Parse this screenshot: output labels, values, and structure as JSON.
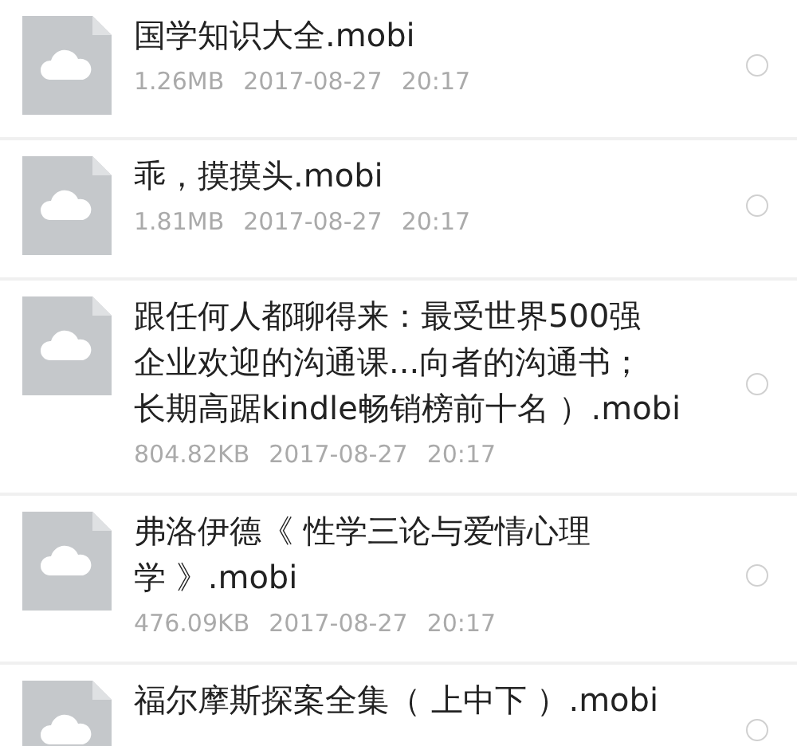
{
  "files": [
    {
      "title_lines": [
        "国学知识大全.mobi"
      ],
      "size": "1.26MB",
      "date": "2017-08-27",
      "time": "20:17",
      "selected": false
    },
    {
      "title_lines": [
        "乖，摸摸头.mobi"
      ],
      "size": "1.81MB",
      "date": "2017-08-27",
      "time": "20:17",
      "selected": false
    },
    {
      "title_lines": [
        "跟任何人都聊得来：最受世界500强",
        "企业欢迎的沟通课...向者的沟通书；",
        "长期高踞kindle畅销榜前十名 ）.mobi"
      ],
      "size": "804.82KB",
      "date": "2017-08-27",
      "time": "20:17",
      "selected": false
    },
    {
      "title_lines": [
        "弗洛伊德《 性学三论与爱情心理",
        "学 》.mobi"
      ],
      "size": "476.09KB",
      "date": "2017-08-27",
      "time": "20:17",
      "selected": false
    },
    {
      "title_lines": [
        "福尔摩斯探案全集（ 上中下 ）.mobi"
      ],
      "selected": false
    }
  ]
}
